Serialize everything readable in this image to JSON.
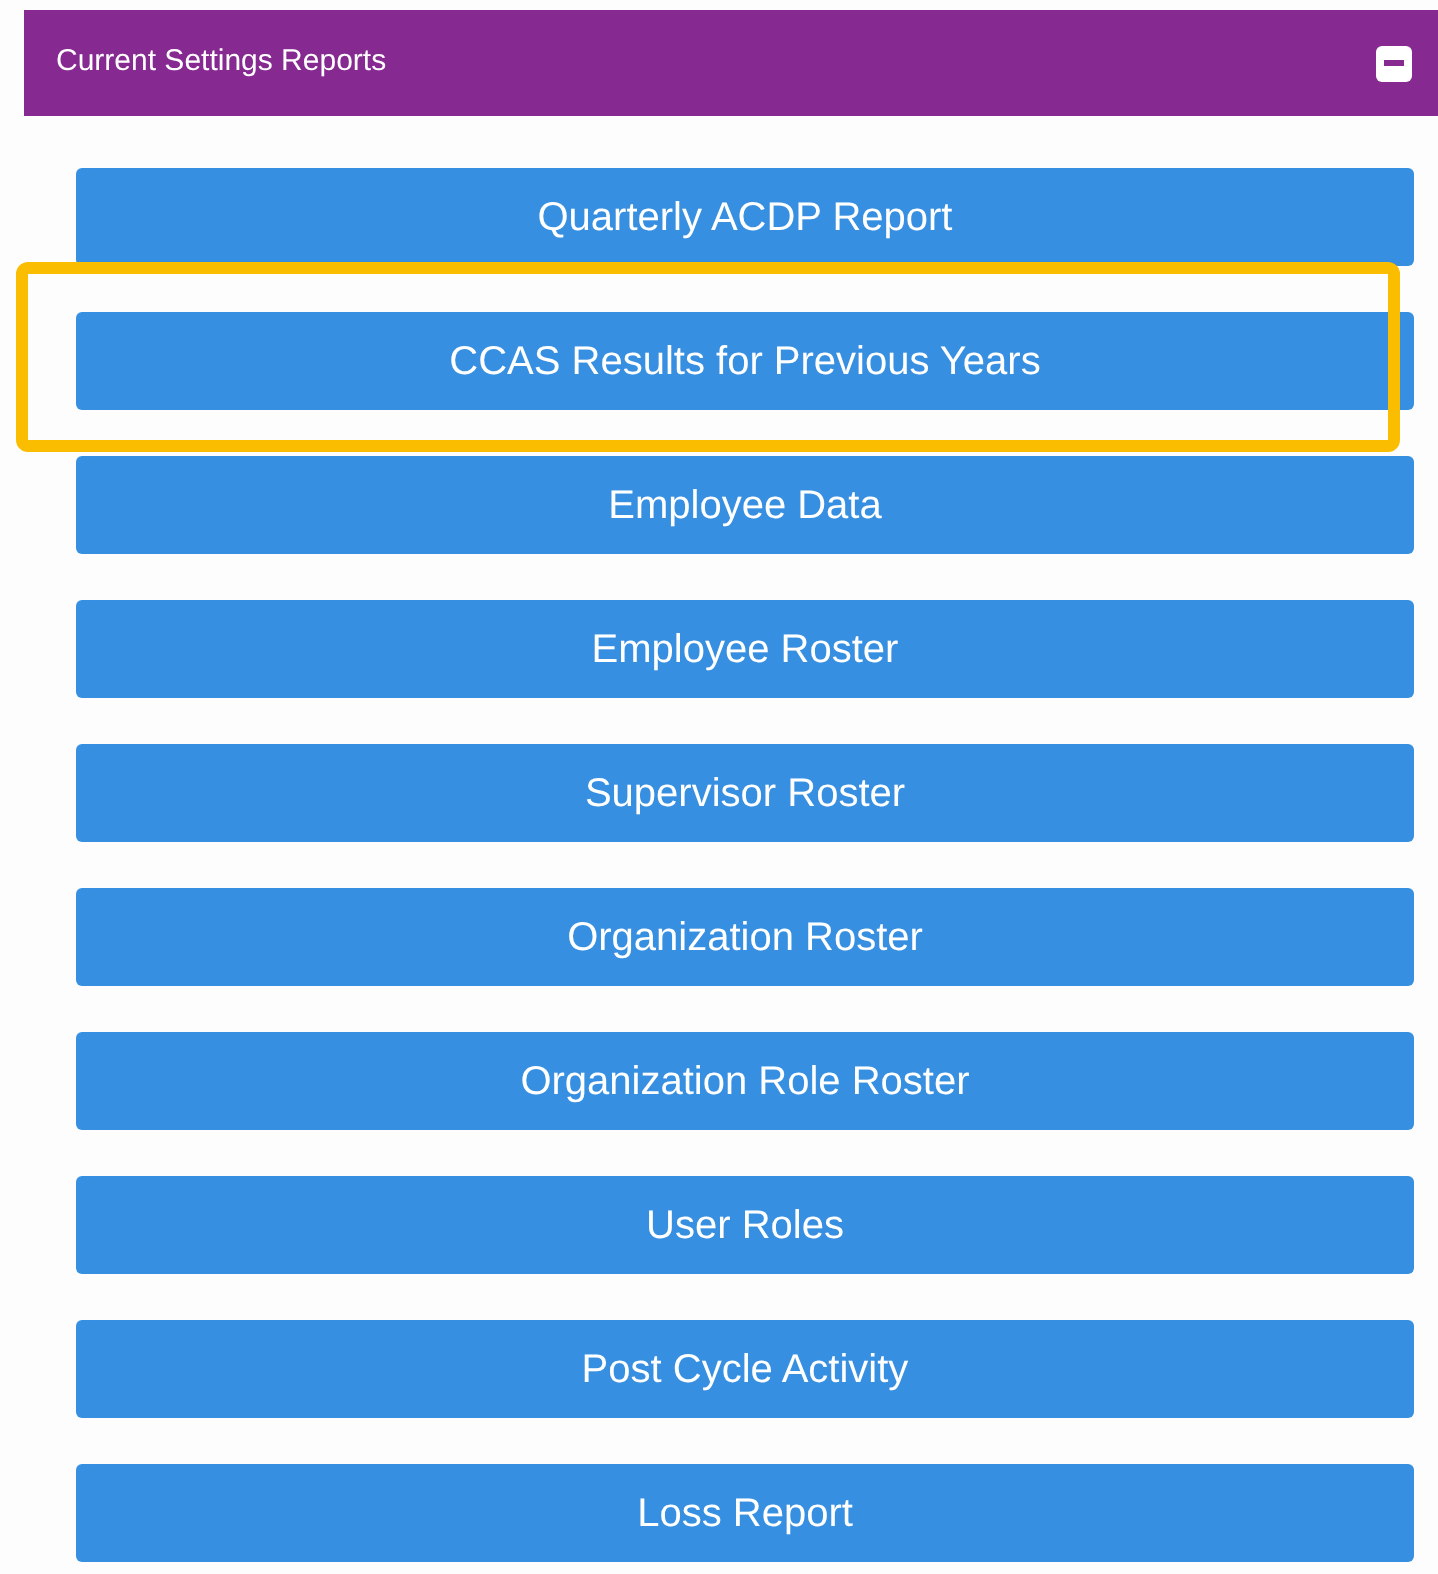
{
  "panel": {
    "title": "Current Settings Reports",
    "expanded": true
  },
  "reports": [
    {
      "label": "Quarterly ACDP Report",
      "highlighted": false
    },
    {
      "label": "CCAS Results for Previous Years",
      "highlighted": true
    },
    {
      "label": "Employee Data",
      "highlighted": false
    },
    {
      "label": "Employee Roster",
      "highlighted": false
    },
    {
      "label": "Supervisor Roster",
      "highlighted": false
    },
    {
      "label": "Organization Roster",
      "highlighted": false
    },
    {
      "label": "Organization Role Roster",
      "highlighted": false
    },
    {
      "label": "User Roles",
      "highlighted": false
    },
    {
      "label": "Post Cycle Activity",
      "highlighted": false
    },
    {
      "label": "Loss Report",
      "highlighted": false
    }
  ]
}
